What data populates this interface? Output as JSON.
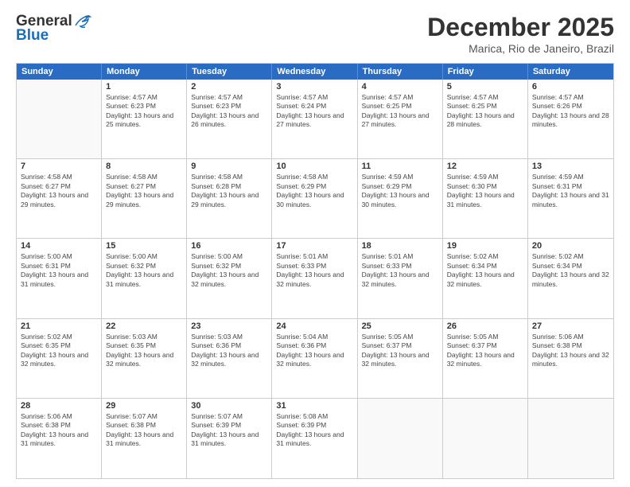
{
  "header": {
    "logo_general": "General",
    "logo_blue": "Blue",
    "month_title": "December 2025",
    "location": "Marica, Rio de Janeiro, Brazil"
  },
  "days_of_week": [
    "Sunday",
    "Monday",
    "Tuesday",
    "Wednesday",
    "Thursday",
    "Friday",
    "Saturday"
  ],
  "weeks": [
    [
      {
        "day": "",
        "empty": true
      },
      {
        "day": "1",
        "sunrise": "Sunrise: 4:57 AM",
        "sunset": "Sunset: 6:23 PM",
        "daylight": "Daylight: 13 hours and 25 minutes."
      },
      {
        "day": "2",
        "sunrise": "Sunrise: 4:57 AM",
        "sunset": "Sunset: 6:23 PM",
        "daylight": "Daylight: 13 hours and 26 minutes."
      },
      {
        "day": "3",
        "sunrise": "Sunrise: 4:57 AM",
        "sunset": "Sunset: 6:24 PM",
        "daylight": "Daylight: 13 hours and 27 minutes."
      },
      {
        "day": "4",
        "sunrise": "Sunrise: 4:57 AM",
        "sunset": "Sunset: 6:25 PM",
        "daylight": "Daylight: 13 hours and 27 minutes."
      },
      {
        "day": "5",
        "sunrise": "Sunrise: 4:57 AM",
        "sunset": "Sunset: 6:25 PM",
        "daylight": "Daylight: 13 hours and 28 minutes."
      },
      {
        "day": "6",
        "sunrise": "Sunrise: 4:57 AM",
        "sunset": "Sunset: 6:26 PM",
        "daylight": "Daylight: 13 hours and 28 minutes."
      }
    ],
    [
      {
        "day": "7",
        "sunrise": "Sunrise: 4:58 AM",
        "sunset": "Sunset: 6:27 PM",
        "daylight": "Daylight: 13 hours and 29 minutes."
      },
      {
        "day": "8",
        "sunrise": "Sunrise: 4:58 AM",
        "sunset": "Sunset: 6:27 PM",
        "daylight": "Daylight: 13 hours and 29 minutes."
      },
      {
        "day": "9",
        "sunrise": "Sunrise: 4:58 AM",
        "sunset": "Sunset: 6:28 PM",
        "daylight": "Daylight: 13 hours and 29 minutes."
      },
      {
        "day": "10",
        "sunrise": "Sunrise: 4:58 AM",
        "sunset": "Sunset: 6:29 PM",
        "daylight": "Daylight: 13 hours and 30 minutes."
      },
      {
        "day": "11",
        "sunrise": "Sunrise: 4:59 AM",
        "sunset": "Sunset: 6:29 PM",
        "daylight": "Daylight: 13 hours and 30 minutes."
      },
      {
        "day": "12",
        "sunrise": "Sunrise: 4:59 AM",
        "sunset": "Sunset: 6:30 PM",
        "daylight": "Daylight: 13 hours and 31 minutes."
      },
      {
        "day": "13",
        "sunrise": "Sunrise: 4:59 AM",
        "sunset": "Sunset: 6:31 PM",
        "daylight": "Daylight: 13 hours and 31 minutes."
      }
    ],
    [
      {
        "day": "14",
        "sunrise": "Sunrise: 5:00 AM",
        "sunset": "Sunset: 6:31 PM",
        "daylight": "Daylight: 13 hours and 31 minutes."
      },
      {
        "day": "15",
        "sunrise": "Sunrise: 5:00 AM",
        "sunset": "Sunset: 6:32 PM",
        "daylight": "Daylight: 13 hours and 31 minutes."
      },
      {
        "day": "16",
        "sunrise": "Sunrise: 5:00 AM",
        "sunset": "Sunset: 6:32 PM",
        "daylight": "Daylight: 13 hours and 32 minutes."
      },
      {
        "day": "17",
        "sunrise": "Sunrise: 5:01 AM",
        "sunset": "Sunset: 6:33 PM",
        "daylight": "Daylight: 13 hours and 32 minutes."
      },
      {
        "day": "18",
        "sunrise": "Sunrise: 5:01 AM",
        "sunset": "Sunset: 6:33 PM",
        "daylight": "Daylight: 13 hours and 32 minutes."
      },
      {
        "day": "19",
        "sunrise": "Sunrise: 5:02 AM",
        "sunset": "Sunset: 6:34 PM",
        "daylight": "Daylight: 13 hours and 32 minutes."
      },
      {
        "day": "20",
        "sunrise": "Sunrise: 5:02 AM",
        "sunset": "Sunset: 6:34 PM",
        "daylight": "Daylight: 13 hours and 32 minutes."
      }
    ],
    [
      {
        "day": "21",
        "sunrise": "Sunrise: 5:02 AM",
        "sunset": "Sunset: 6:35 PM",
        "daylight": "Daylight: 13 hours and 32 minutes."
      },
      {
        "day": "22",
        "sunrise": "Sunrise: 5:03 AM",
        "sunset": "Sunset: 6:35 PM",
        "daylight": "Daylight: 13 hours and 32 minutes."
      },
      {
        "day": "23",
        "sunrise": "Sunrise: 5:03 AM",
        "sunset": "Sunset: 6:36 PM",
        "daylight": "Daylight: 13 hours and 32 minutes."
      },
      {
        "day": "24",
        "sunrise": "Sunrise: 5:04 AM",
        "sunset": "Sunset: 6:36 PM",
        "daylight": "Daylight: 13 hours and 32 minutes."
      },
      {
        "day": "25",
        "sunrise": "Sunrise: 5:05 AM",
        "sunset": "Sunset: 6:37 PM",
        "daylight": "Daylight: 13 hours and 32 minutes."
      },
      {
        "day": "26",
        "sunrise": "Sunrise: 5:05 AM",
        "sunset": "Sunset: 6:37 PM",
        "daylight": "Daylight: 13 hours and 32 minutes."
      },
      {
        "day": "27",
        "sunrise": "Sunrise: 5:06 AM",
        "sunset": "Sunset: 6:38 PM",
        "daylight": "Daylight: 13 hours and 32 minutes."
      }
    ],
    [
      {
        "day": "28",
        "sunrise": "Sunrise: 5:06 AM",
        "sunset": "Sunset: 6:38 PM",
        "daylight": "Daylight: 13 hours and 31 minutes."
      },
      {
        "day": "29",
        "sunrise": "Sunrise: 5:07 AM",
        "sunset": "Sunset: 6:38 PM",
        "daylight": "Daylight: 13 hours and 31 minutes."
      },
      {
        "day": "30",
        "sunrise": "Sunrise: 5:07 AM",
        "sunset": "Sunset: 6:39 PM",
        "daylight": "Daylight: 13 hours and 31 minutes."
      },
      {
        "day": "31",
        "sunrise": "Sunrise: 5:08 AM",
        "sunset": "Sunset: 6:39 PM",
        "daylight": "Daylight: 13 hours and 31 minutes."
      },
      {
        "day": "",
        "empty": true
      },
      {
        "day": "",
        "empty": true
      },
      {
        "day": "",
        "empty": true
      }
    ]
  ]
}
